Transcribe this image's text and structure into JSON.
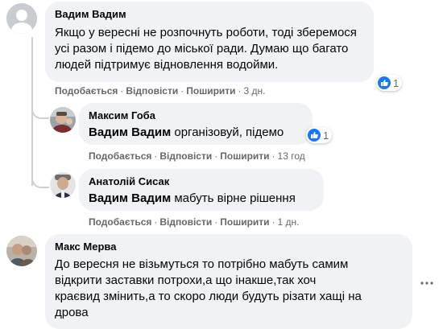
{
  "comments": [
    {
      "author": "Вадим Вадим",
      "lines": [
        "Якщо у вересні не розпочнуть роботи, тоді зберемося",
        "усі разом і підемо до міської ради. Думаю що багато",
        "людей підтримує відновлення водойми."
      ],
      "reactions": "1",
      "actions": {
        "like": "Подобається",
        "reply": "Відповісти",
        "share": "Поширити",
        "time": "3 дн."
      }
    },
    {
      "author": "Максим Гоба",
      "mention": "Вадим Вадим",
      "text": " організовуй, підемо",
      "reactions": "1",
      "actions": {
        "like": "Подобається",
        "reply": "Відповісти",
        "share": "Поширити",
        "time": "13 год"
      }
    },
    {
      "author": "Анатолій Сисак",
      "mention": "Вадим Вадим",
      "text": " мабуть вірне рішення",
      "actions": {
        "like": "Подобається",
        "reply": "Відповісти",
        "share": "Поширити",
        "time": "1 дн."
      }
    },
    {
      "author": "Макс Мерва",
      "lines": [
        "До вересня не візьмуться то потрібно мабуть самим",
        "відкрити заставки потрохи,а що інакше,так хоч",
        "краєвид змінить,а то скоро люди будуть різати хащі на",
        "дрова"
      ]
    }
  ],
  "icons": {
    "like": "like-thumb-icon",
    "more": "more-options-icon"
  },
  "colors": {
    "like_blue": "#1877f2",
    "bubble": "#f0f2f5",
    "meta": "#65676b"
  }
}
